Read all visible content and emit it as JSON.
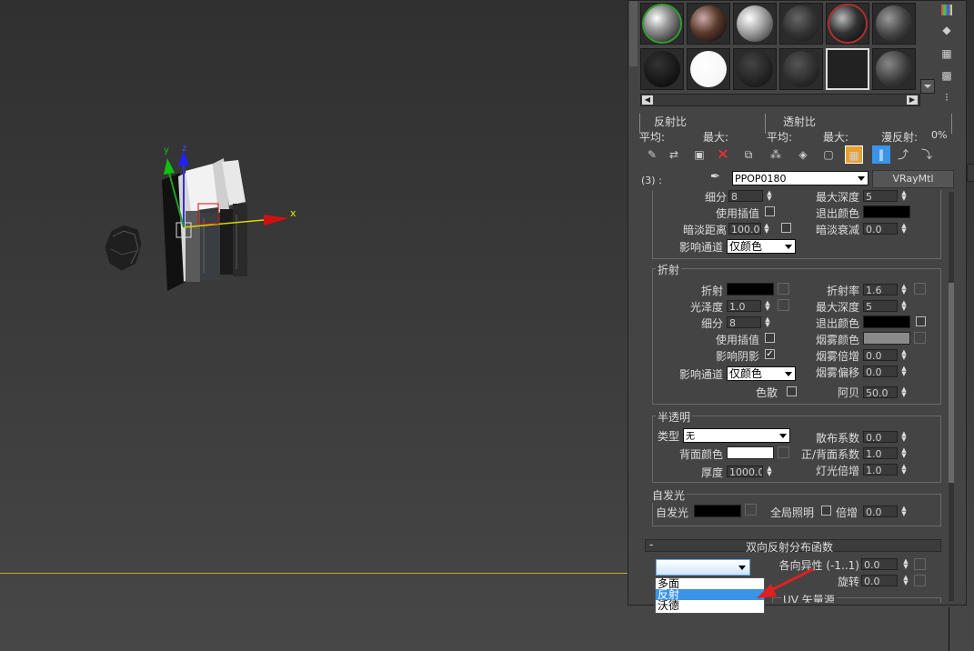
{
  "viewport": {
    "axis_x_label": "x",
    "axis_y_label": "y",
    "axis_z_label": "z"
  },
  "colors": {
    "accent": "#3a94e8",
    "viewport_line": "#bfae2a",
    "panel_bg": "#444444"
  },
  "material_editor": {
    "reflect_stats": {
      "title": "反射比",
      "avg": "平均:",
      "max": "最大:"
    },
    "transmit_stats": {
      "title": "透射比",
      "avg": "平均:",
      "max": "最大:",
      "diffuse": "漫反射:",
      "diffuse_val": "0%"
    },
    "material_index": "(3) :",
    "material_name": "PPOP0180",
    "material_type": "VRayMtl",
    "reflection_tail": {
      "subdivs_label": "细分",
      "subdivs_val": "8",
      "max_depth_label": "最大深度",
      "max_depth_val": "5",
      "interp_label": "使用插值",
      "exit_color_label": "退出颜色",
      "dim_dist_label": "暗淡距离",
      "dim_dist_val": "100.0m",
      "dim_falloff_label": "暗淡衰减",
      "dim_falloff_val": "0.0",
      "affect_channels_label": "影响通道",
      "affect_channels_val": "仅颜色"
    },
    "refraction": {
      "title": "折射",
      "refract_label": "折射",
      "ior_label": "折射率",
      "ior_val": "1.6",
      "gloss_label": "光泽度",
      "gloss_val": "1.0",
      "max_depth_label": "最大深度",
      "max_depth_val": "5",
      "subdivs_label": "细分",
      "subdivs_val": "8",
      "exit_color_label": "退出颜色",
      "interp_label": "使用插值",
      "fog_color_label": "烟雾颜色",
      "affect_shadows_label": "影响阴影",
      "fog_mult_label": "烟雾倍增",
      "fog_mult_val": "0.0",
      "affect_channels_label": "影响通道",
      "affect_channels_val": "仅颜色",
      "fog_bias_label": "烟雾偏移",
      "fog_bias_val": "0.0",
      "dispersion_label": "色散",
      "abbe_label": "阿贝",
      "abbe_val": "50.0"
    },
    "translucency": {
      "title": "半透明",
      "type_label": "类型",
      "type_val": "无",
      "scatter_label": "散布系数",
      "scatter_val": "0.0",
      "back_color_label": "背面颜色",
      "fb_label": "正/背面系数",
      "fb_val": "1.0",
      "thickness_label": "厚度",
      "thickness_val": "1000.0",
      "light_mult_label": "灯光倍增",
      "light_mult_val": "1.0"
    },
    "self_illum": {
      "title": "自发光",
      "label": "自发光",
      "gi_label": "全局照明",
      "mult_label": "倍增",
      "mult_val": "0.0"
    },
    "brdf": {
      "collapse": "-",
      "title": "双向反射分布函数",
      "aniso_label": "各向异性 (-1..1)",
      "aniso_val": "0.0",
      "rotation_label": "旋转",
      "rotation_val": "0.0",
      "uv_label": "UV 矢量源",
      "dropdown_options": [
        "多面",
        "反射",
        "沃德"
      ],
      "dropdown_selected_index": 1
    }
  }
}
